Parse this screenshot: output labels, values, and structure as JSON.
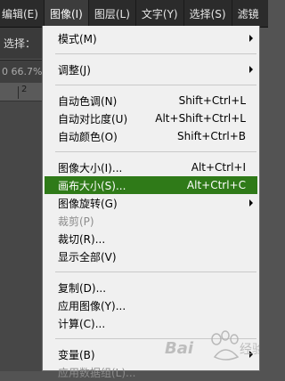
{
  "menubar": {
    "items": [
      {
        "label": "编辑(E)"
      },
      {
        "label": "图像(I)"
      },
      {
        "label": "图层(L)"
      },
      {
        "label": "文字(Y)"
      },
      {
        "label": "选择(S)"
      },
      {
        "label": "滤镜"
      }
    ]
  },
  "options_bar": {
    "label": "选择："
  },
  "doc_tab": {
    "zoom": "0 66.7%"
  },
  "ruler": {
    "number": "2"
  },
  "menu": {
    "items": [
      {
        "label": "模式(M)",
        "shortcut": "",
        "submenu": true
      },
      {
        "label": "调整(J)",
        "shortcut": "",
        "submenu": true
      },
      {
        "label": "自动色调(N)",
        "shortcut": "Shift+Ctrl+L"
      },
      {
        "label": "自动对比度(U)",
        "shortcut": "Alt+Shift+Ctrl+L"
      },
      {
        "label": "自动颜色(O)",
        "shortcut": "Shift+Ctrl+B"
      },
      {
        "label": "图像大小(I)...",
        "shortcut": "Alt+Ctrl+I"
      },
      {
        "label": "画布大小(S)...",
        "shortcut": "Alt+Ctrl+C",
        "highlighted": true
      },
      {
        "label": "图像旋转(G)",
        "shortcut": "",
        "submenu": true
      },
      {
        "label": "裁剪(P)",
        "shortcut": "",
        "disabled": true
      },
      {
        "label": "裁切(R)...",
        "shortcut": ""
      },
      {
        "label": "显示全部(V)",
        "shortcut": ""
      },
      {
        "label": "复制(D)...",
        "shortcut": ""
      },
      {
        "label": "应用图像(Y)...",
        "shortcut": ""
      },
      {
        "label": "计算(C)...",
        "shortcut": ""
      },
      {
        "label": "变量(B)",
        "shortcut": "",
        "submenu": true
      },
      {
        "label": "应用数据组(L)...",
        "shortcut": "",
        "disabled": true
      }
    ]
  },
  "watermark": {
    "text": "Bai度经验"
  },
  "colors": {
    "highlight": "#2f7a18",
    "menubar": "#2b2b2b",
    "menu_bg": "#f0f0f0"
  }
}
